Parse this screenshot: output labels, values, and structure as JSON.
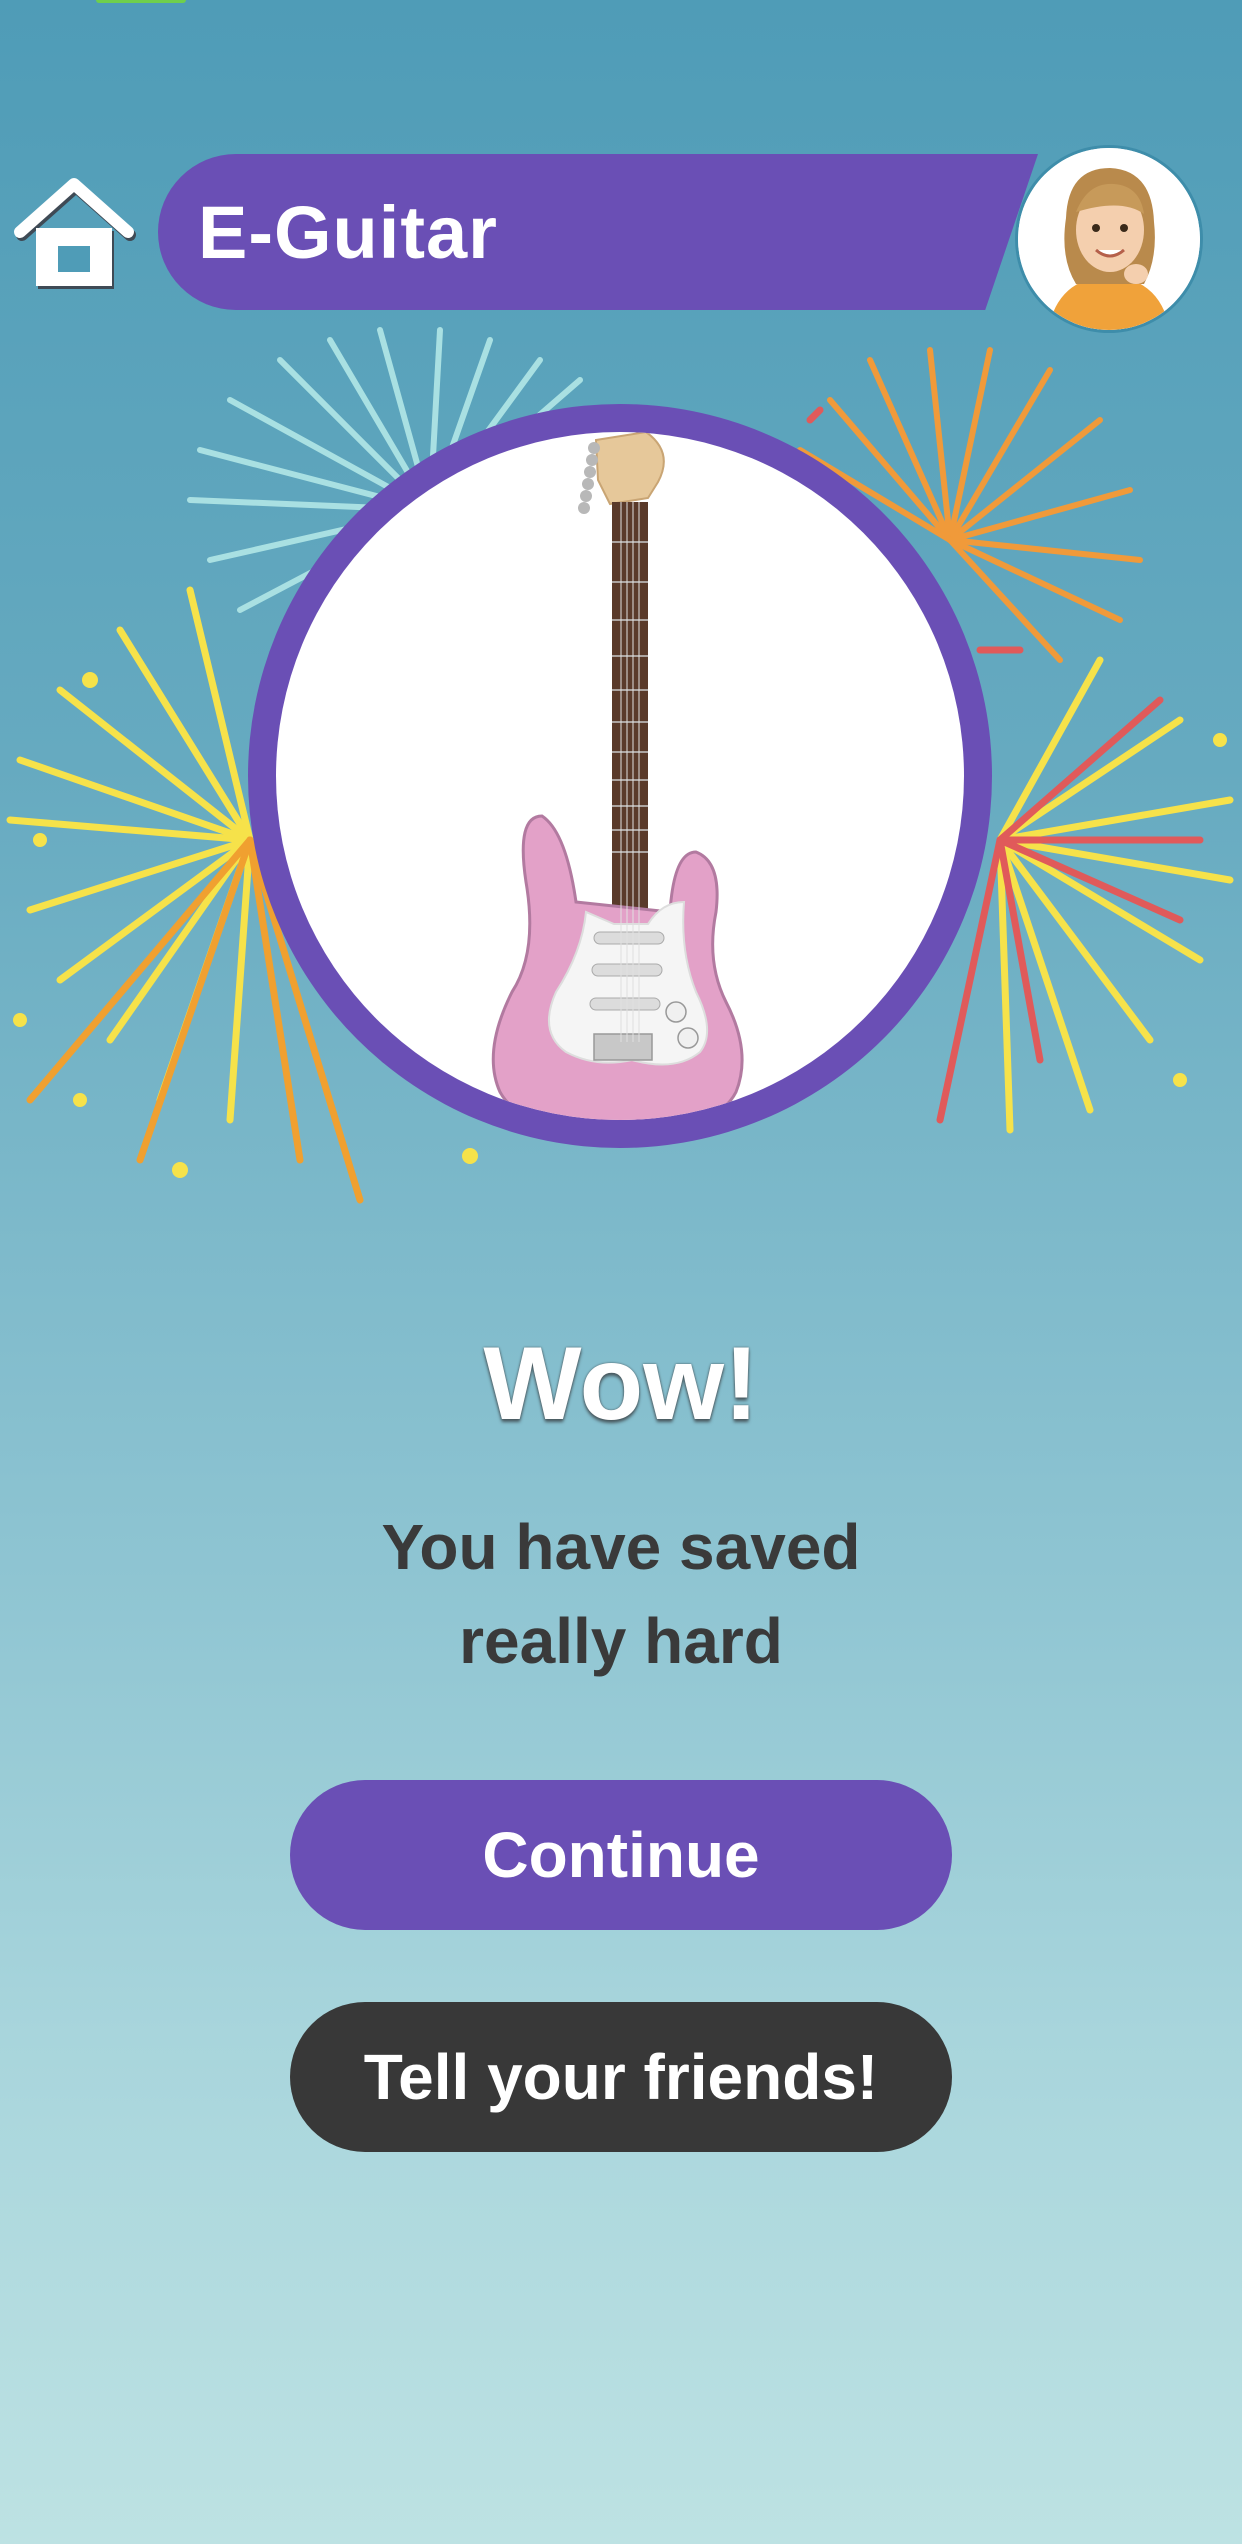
{
  "header": {
    "title": "E-Guitar",
    "home_icon": "home-icon",
    "avatar_icon": "child-avatar"
  },
  "product": {
    "image_icon": "electric-guitar-image"
  },
  "message": {
    "headline": "Wow!",
    "line1": "You have saved",
    "line2": "really hard"
  },
  "actions": {
    "continue_label": "Continue",
    "tell_label": "Tell your friends!"
  },
  "colors": {
    "brand_purple": "#6a4fb5",
    "dark_button": "#383838",
    "guitar_pink": "#e3a1c8"
  }
}
